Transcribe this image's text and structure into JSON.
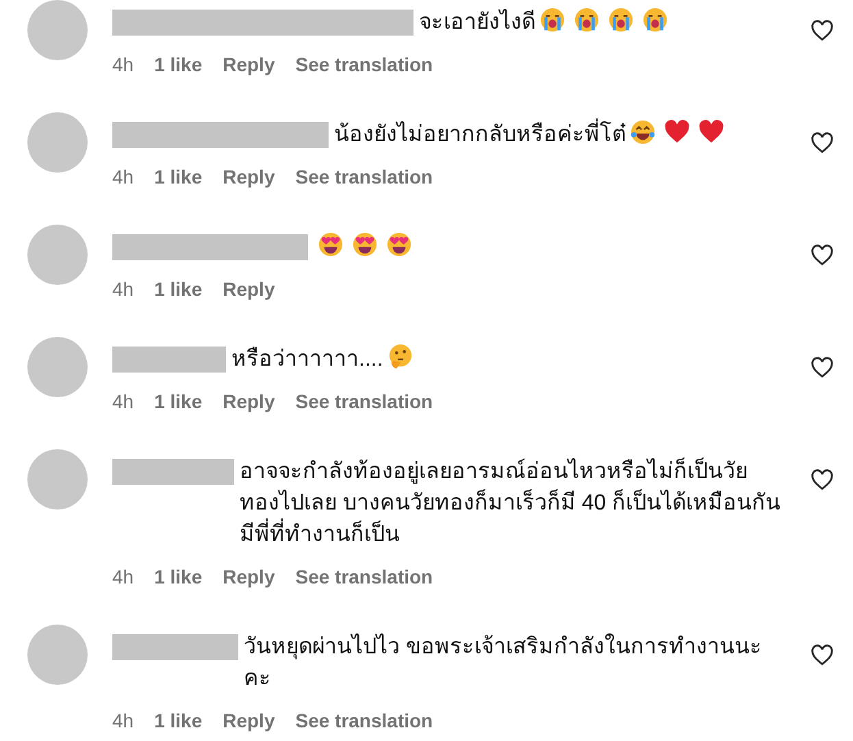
{
  "comments": [
    {
      "text": "จะเอายังไงดี",
      "emojis": [
        {
          "kind": "crying"
        },
        {
          "kind": "crying"
        },
        {
          "kind": "crying"
        },
        {
          "kind": "crying"
        }
      ],
      "time": "4h",
      "likes": "1 like",
      "reply": "Reply",
      "translation": "See translation",
      "liked": false
    },
    {
      "text": "น้องยังไม่อยากกลับหรือค่ะพี่โต๋",
      "emojis": [
        {
          "kind": "laughing"
        },
        {
          "kind": "heart"
        },
        {
          "kind": "heart"
        }
      ],
      "time": "4h",
      "likes": "1 like",
      "reply": "Reply",
      "translation": "See translation",
      "liked": false
    },
    {
      "emojis": [
        {
          "kind": "heart-eyes"
        },
        {
          "kind": "heart-eyes"
        },
        {
          "kind": "heart-eyes"
        }
      ],
      "time": "4h",
      "likes": "1 like",
      "reply": "Reply",
      "liked": false
    },
    {
      "text": "หรือว่าาาาาา....",
      "emojis": [
        {
          "kind": "thinking"
        }
      ],
      "time": "4h",
      "likes": "1 like",
      "reply": "Reply",
      "translation": "See translation",
      "liked": false
    },
    {
      "text": "อาจจะกำลังท้องอยู่เลยอารมณ์อ่อนไหวหรือไม่ก็เป็นวัยทองไปเลย บางคนวัยทองก็มาเร็วก็มี 40 ก็เป็นได้เหมือนกัน มีพี่ที่ทำงานก็เป็น",
      "time": "4h",
      "likes": "1 like",
      "reply": "Reply",
      "translation": "See translation",
      "liked": false
    },
    {
      "text": "วันหยุดผ่านไปไว ขอพระเจ้าเสริมกำลังในการทำงานนะคะ",
      "time": "4h",
      "likes": "1 like",
      "reply": "Reply",
      "translation": "See translation",
      "liked": false
    }
  ]
}
